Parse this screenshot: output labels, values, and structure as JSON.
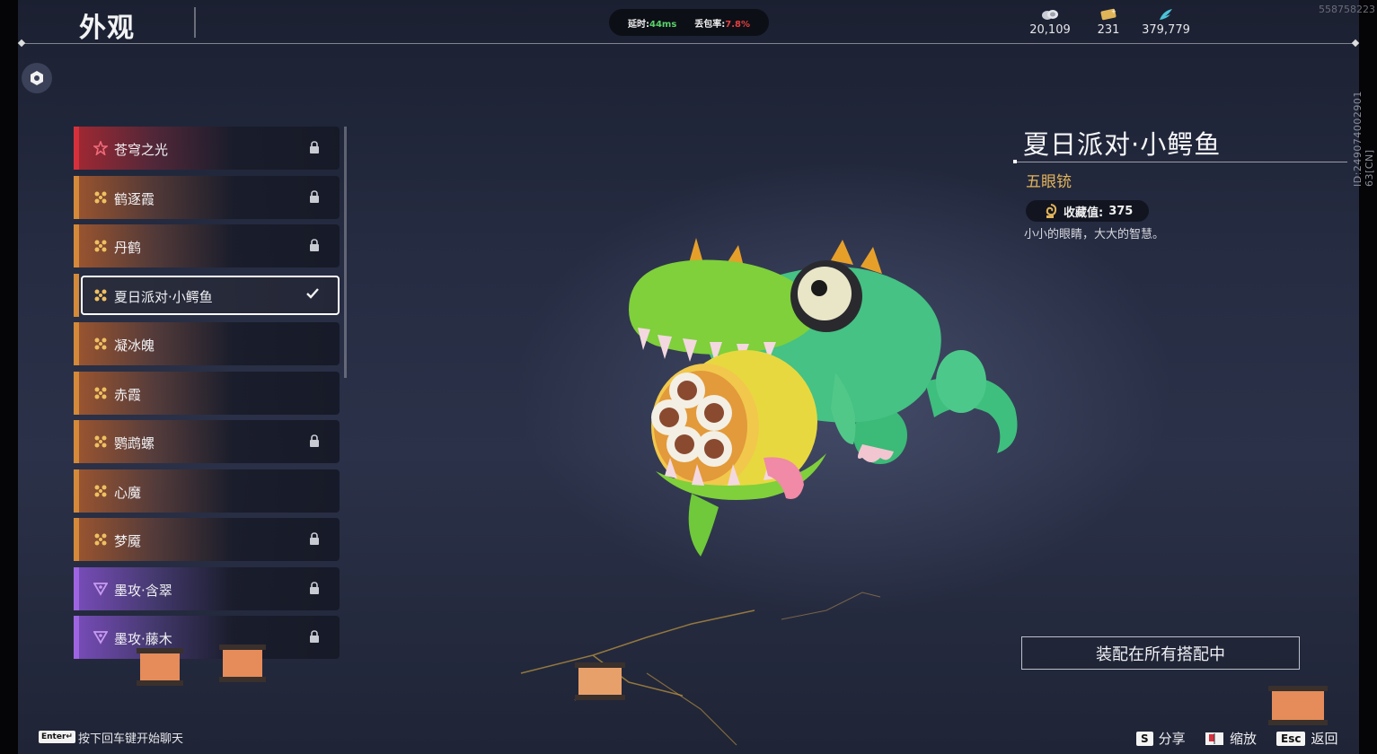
{
  "header": {
    "title": "外观",
    "network": {
      "latency_label": "延时:",
      "latency_value": "44ms",
      "loss_label": "丢包率:",
      "loss_value": "7.8%"
    },
    "currencies": [
      {
        "icon": "coin-stack-icon",
        "value": "20,109"
      },
      {
        "icon": "ticket-icon",
        "value": "231"
      },
      {
        "icon": "feather-icon",
        "value": "379,779"
      }
    ],
    "uid": "558758223",
    "id_vertical": "ID:249074002901​63[CN]"
  },
  "skin_list": {
    "items": [
      {
        "label": "苍穹之光",
        "rarity": "red",
        "locked": true,
        "selected": false
      },
      {
        "label": "鹤逐霞",
        "rarity": "gold",
        "locked": true,
        "selected": false
      },
      {
        "label": "丹鹤",
        "rarity": "gold",
        "locked": true,
        "selected": false
      },
      {
        "label": "夏日派对·小鳄鱼",
        "rarity": "gold",
        "locked": false,
        "selected": true
      },
      {
        "label": "凝冰魄",
        "rarity": "gold",
        "locked": false,
        "selected": false
      },
      {
        "label": "赤霞",
        "rarity": "gold",
        "locked": false,
        "selected": false
      },
      {
        "label": "鹦鹉螺",
        "rarity": "gold",
        "locked": true,
        "selected": false
      },
      {
        "label": "心魔",
        "rarity": "gold",
        "locked": false,
        "selected": false
      },
      {
        "label": "梦魇",
        "rarity": "gold",
        "locked": true,
        "selected": false
      },
      {
        "label": "墨攻·含翠",
        "rarity": "purple",
        "locked": true,
        "selected": false
      },
      {
        "label": "墨攻·藤木",
        "rarity": "purple",
        "locked": true,
        "selected": false
      }
    ]
  },
  "detail": {
    "name": "夏日派对·小鳄鱼",
    "weapon_type": "五眼铳",
    "collection_label": "收藏值:",
    "collection_value": "375",
    "description": "小小的眼睛，大大的智慧。",
    "equip_button": "装配在所有搭配中"
  },
  "footer": {
    "enter_key": "Enter↵",
    "chat_hint": "按下回车键开始聊天",
    "share_key": "S",
    "share_label": "分享",
    "zoom_label": "缩放",
    "back_key": "Esc",
    "back_label": "返回"
  },
  "colors": {
    "red": "#d5313d",
    "gold": "#d38a3a",
    "purple": "#9d66e0",
    "ping_ok": "#59d26a",
    "loss_bad": "#e34040",
    "type_gold": "#e2b45a"
  }
}
